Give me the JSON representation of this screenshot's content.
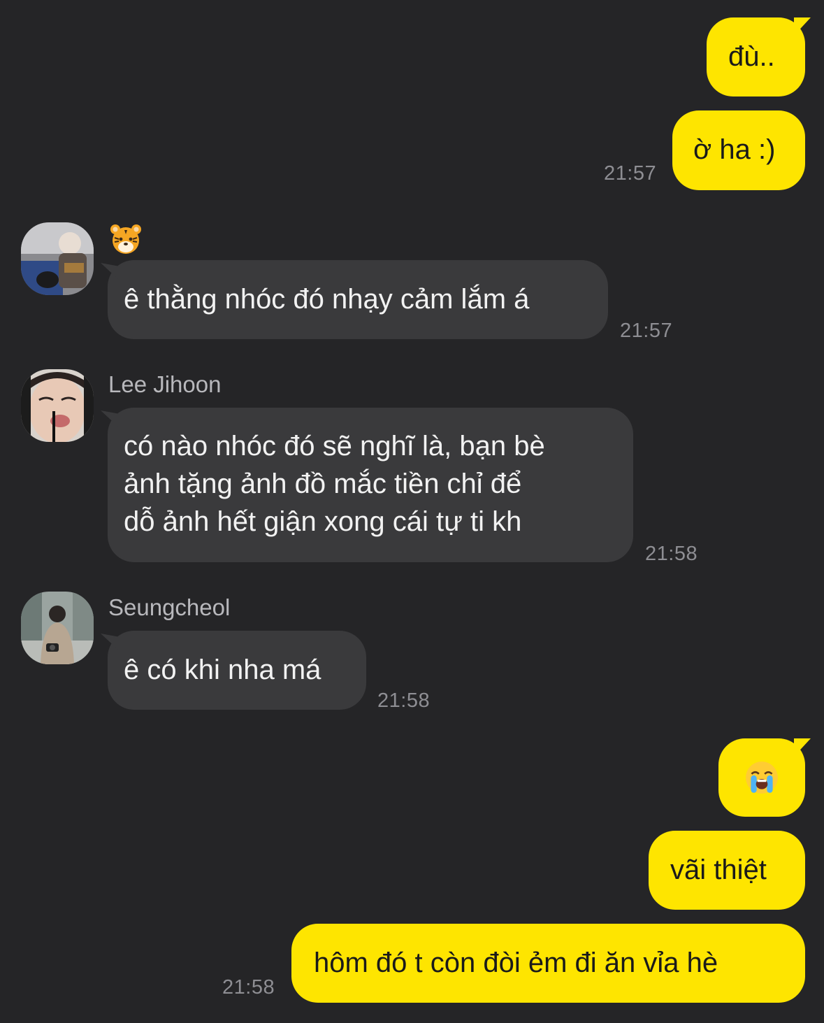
{
  "messages": {
    "m1": {
      "text": "đù.."
    },
    "m2": {
      "text": "ờ ha :)",
      "time": "21:57"
    },
    "m3": {
      "sender": "🐯",
      "text": "ê thằng nhóc đó nhạy cảm lắm á",
      "time": "21:57"
    },
    "m4": {
      "sender": "Lee Jihoon",
      "lines": [
        "có nào nhóc đó sẽ nghĩ là, bạn bè",
        "ảnh tặng ảnh đồ mắc tiền chỉ để",
        "dỗ ảnh hết giận xong cái tự ti kh"
      ],
      "time": "21:58"
    },
    "m5": {
      "sender": "Seungcheol",
      "text": "ê có khi nha má",
      "time": "21:58"
    },
    "m6": {
      "text": "😭",
      "icon": "loudly-crying-face-emoji"
    },
    "m7": {
      "text": "vãi thiệt"
    },
    "m8": {
      "text": "hôm đó t còn đòi ẻm đi ăn vỉa hè",
      "time": "21:58"
    }
  },
  "colors": {
    "background": "#252527",
    "outgoing_bubble": "#fee500",
    "incoming_bubble": "#3a3a3c",
    "timestamp": "#8e8e93",
    "sender_name": "#b8b8bc"
  }
}
